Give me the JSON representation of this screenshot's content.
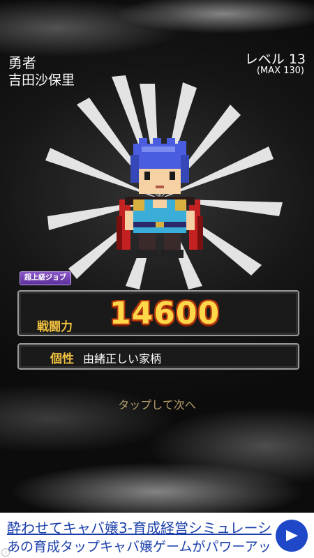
{
  "hero": {
    "class_name": "勇者",
    "name": "吉田沙保里",
    "level_label": "レベル 13",
    "level_max": "(MAX 130)"
  },
  "job_badge": "超上級ジョブ",
  "stats": {
    "power_label": "戦闘力",
    "power_value": "14600",
    "trait_label": "個性",
    "trait_value": "由緒正しい家柄"
  },
  "tap_prompt": "タップして次へ",
  "ad": {
    "line1": "酔わせてキャバ嬢3-育成経営シミュレーシ",
    "line2": "あの育成タップキャバ嬢ゲームがパワーアッ",
    "info_glyph": "i",
    "button_icon": "play-arrow-icon",
    "button_color": "#1e48c8"
  },
  "colors": {
    "gold": "#f0c040",
    "power_fill": "#ffd84a",
    "power_outline": "#b3360c",
    "badge": "#7a48b8",
    "hair": "#4a5de0",
    "tunic": "#3aaed8",
    "cape": "#c42222"
  }
}
